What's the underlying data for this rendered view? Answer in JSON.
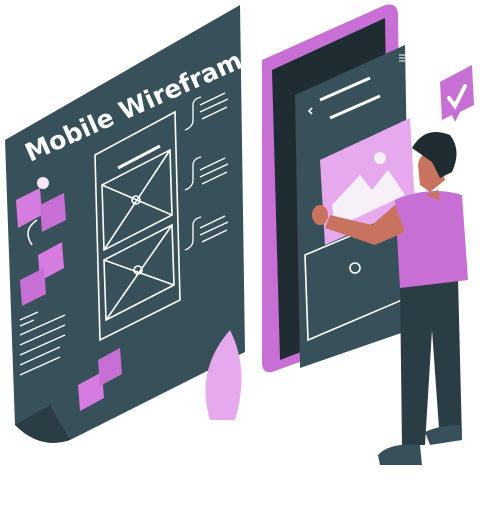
{
  "board": {
    "title": "Mobile Wireframe"
  },
  "colors": {
    "board": "#37505a",
    "board_dark": "#2a3d45",
    "accent": "#c86fd6",
    "accent_light": "#e6a9ee",
    "skin": "#c8735f",
    "hair": "#1f2d33",
    "line": "#ffffff"
  },
  "icons": [
    "checkmark-badge-icon",
    "image-placeholder-icon",
    "camera-icon",
    "home-icon",
    "search-icon",
    "heart-icon",
    "location-icon",
    "menu-icon",
    "back-arrow-icon"
  ]
}
